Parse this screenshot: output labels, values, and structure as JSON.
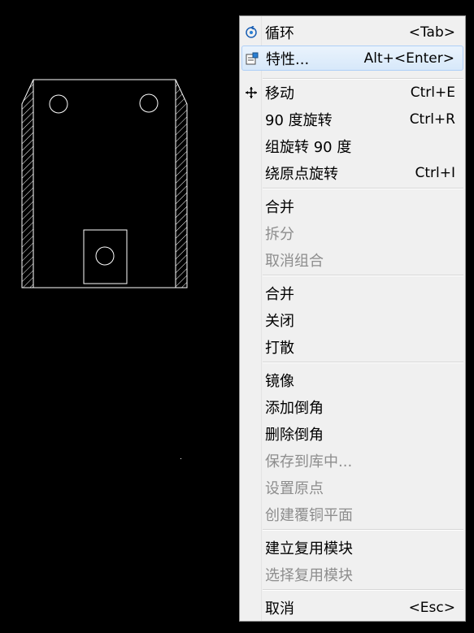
{
  "colors": {
    "canvas_background": "#000000",
    "drawing_stroke": "#ffffff",
    "menu_background": "#f0f0f0",
    "menu_highlight": "#d7e8fa",
    "disabled_text": "#8d8d8d"
  },
  "context_menu": {
    "items": [
      {
        "label": "循环",
        "shortcut": "<Tab>",
        "icon": "cycle-icon",
        "enabled": true,
        "highlighted": false
      },
      {
        "label": "特性...",
        "shortcut": "Alt+<Enter>",
        "icon": "properties-icon",
        "enabled": true,
        "highlighted": true
      },
      {
        "separator": true
      },
      {
        "label": "移动",
        "shortcut": "Ctrl+E",
        "icon": "move-icon",
        "enabled": true
      },
      {
        "label": "90 度旋转",
        "shortcut": "Ctrl+R",
        "enabled": true
      },
      {
        "label": "组旋转 90 度",
        "shortcut": "",
        "enabled": true
      },
      {
        "label": "绕原点旋转",
        "shortcut": "Ctrl+I",
        "enabled": true
      },
      {
        "separator": true
      },
      {
        "label": "合并",
        "shortcut": "",
        "enabled": true
      },
      {
        "label": "拆分",
        "shortcut": "",
        "enabled": false
      },
      {
        "label": "取消组合",
        "shortcut": "",
        "enabled": false
      },
      {
        "separator": true
      },
      {
        "label": "合并",
        "shortcut": "",
        "enabled": true
      },
      {
        "label": "关闭",
        "shortcut": "",
        "enabled": true
      },
      {
        "label": "打散",
        "shortcut": "",
        "enabled": true
      },
      {
        "separator": true
      },
      {
        "label": "镜像",
        "shortcut": "",
        "enabled": true
      },
      {
        "label": "添加倒角",
        "shortcut": "",
        "enabled": true
      },
      {
        "label": "删除倒角",
        "shortcut": "",
        "enabled": true
      },
      {
        "label": "保存到库中...",
        "shortcut": "",
        "enabled": false
      },
      {
        "label": "设置原点",
        "shortcut": "",
        "enabled": false
      },
      {
        "label": "创建覆铜平面",
        "shortcut": "",
        "enabled": false
      },
      {
        "separator": true
      },
      {
        "label": "建立复用模块",
        "shortcut": "",
        "enabled": true
      },
      {
        "label": "选择复用模块",
        "shortcut": "",
        "enabled": false
      },
      {
        "separator": true
      },
      {
        "label": "取消",
        "shortcut": "<Esc>",
        "enabled": true
      }
    ]
  }
}
